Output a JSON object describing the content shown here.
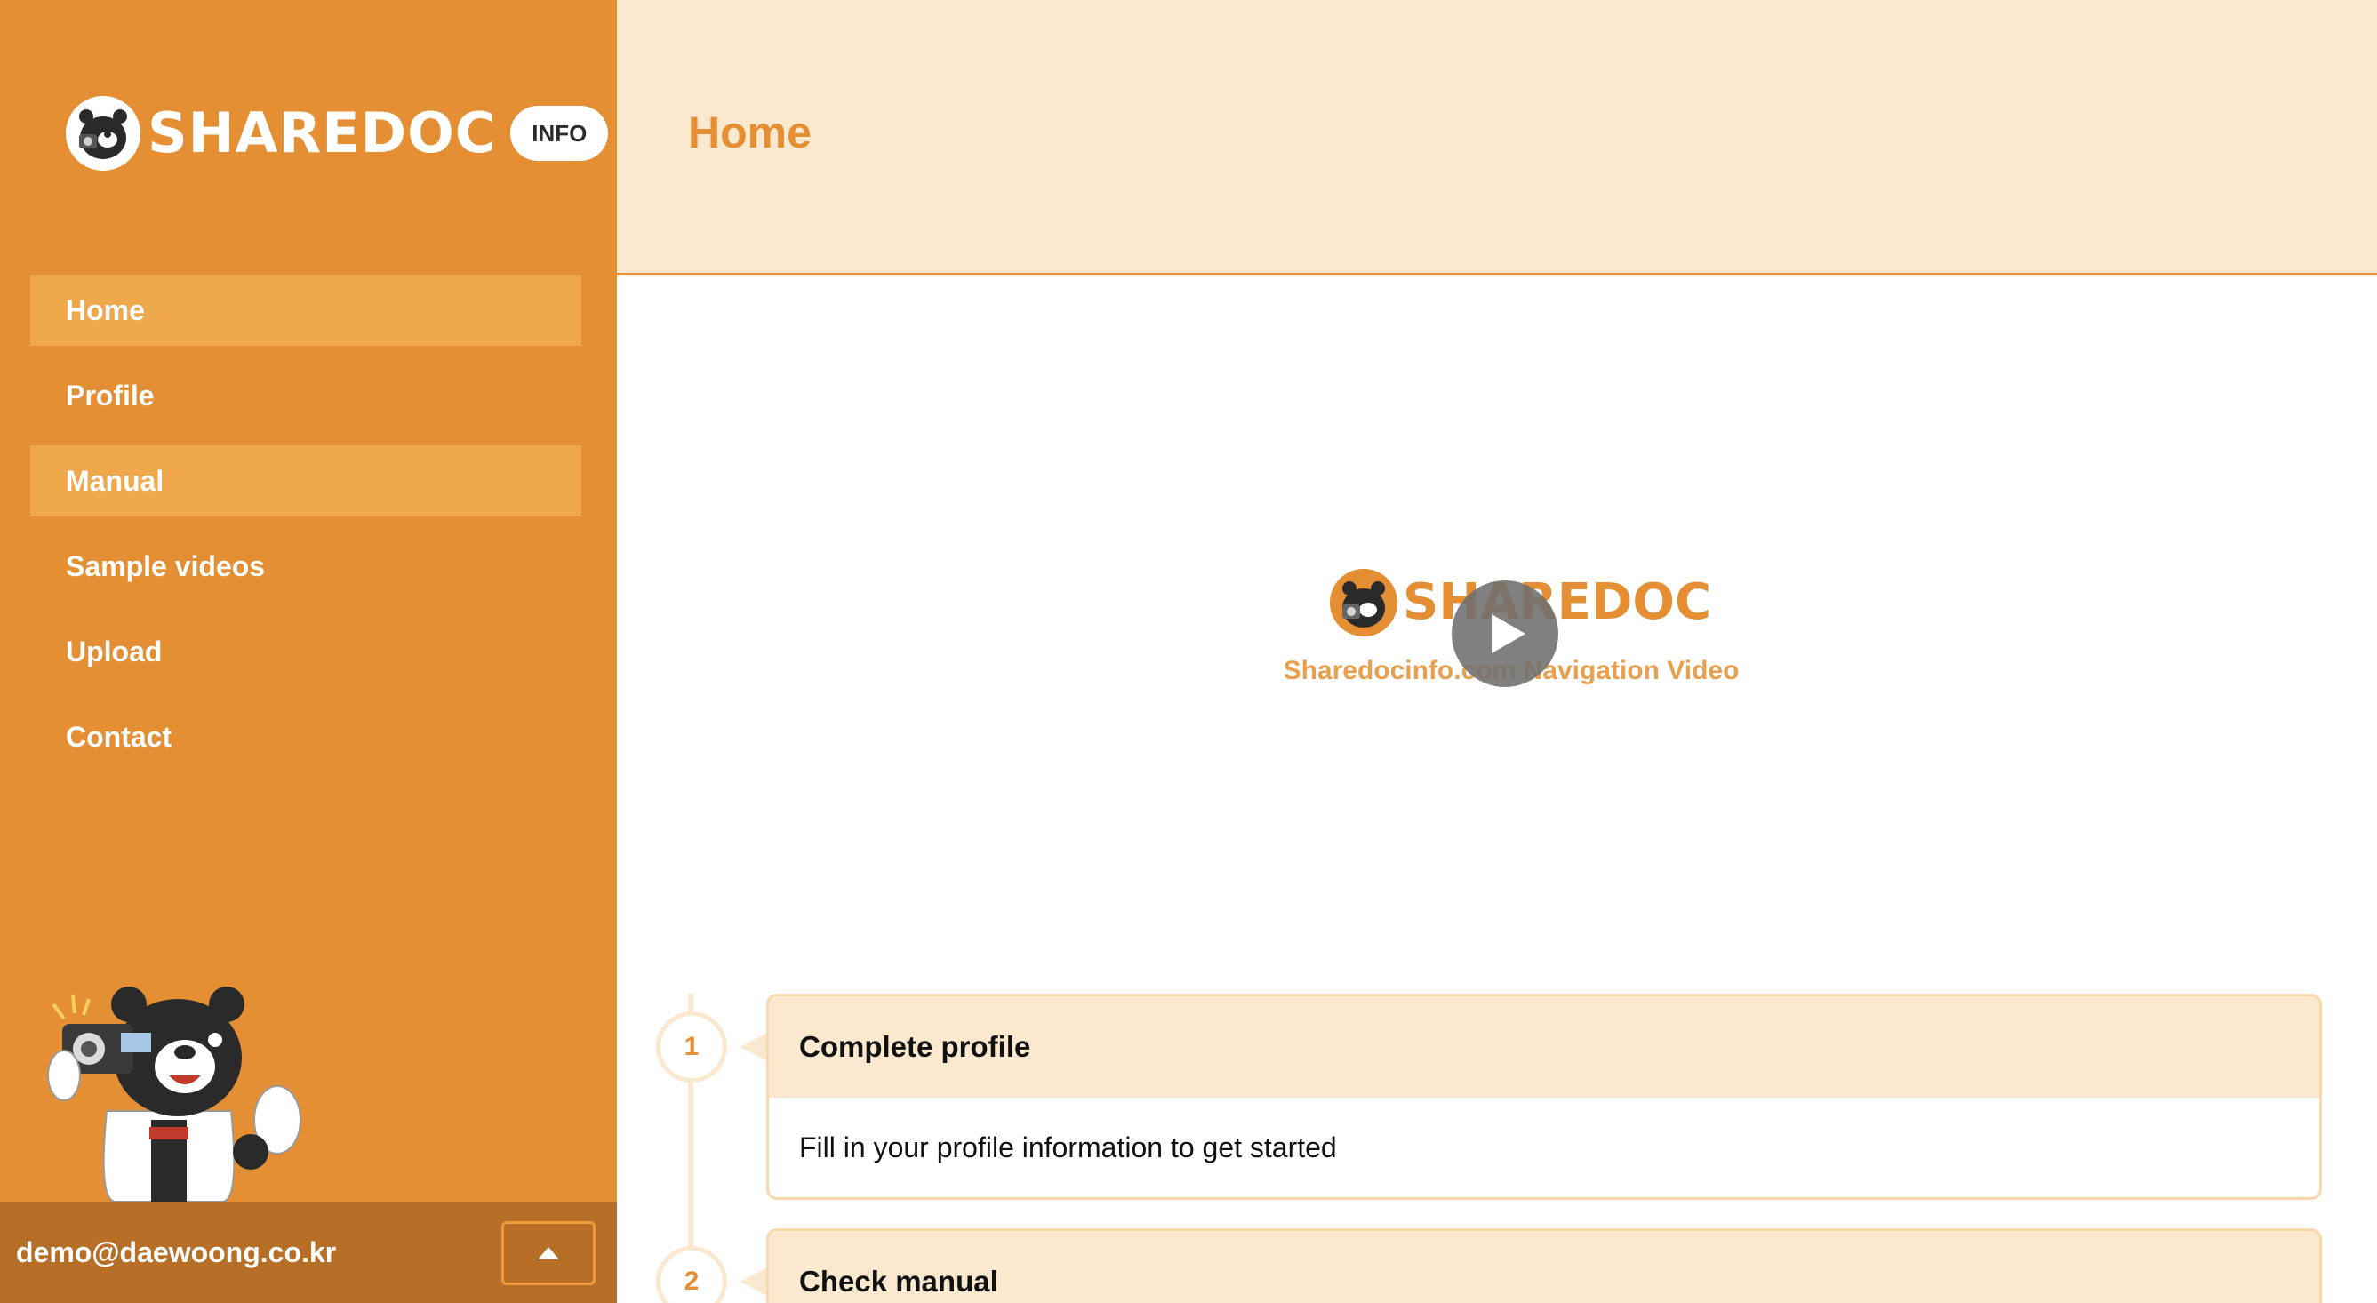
{
  "sidebar": {
    "logo_text": "SHAREDOC",
    "logo_badge": "INFO",
    "items": [
      {
        "label": "Home",
        "active": true
      },
      {
        "label": "Profile",
        "active": false
      },
      {
        "label": "Manual",
        "active": true
      },
      {
        "label": "Sample videos",
        "active": false
      },
      {
        "label": "Upload",
        "active": false
      },
      {
        "label": "Contact",
        "active": false
      }
    ],
    "user_email": "demo@daewoong.co.kr",
    "toggle_icon": "caret-up-icon"
  },
  "header": {
    "title": "Home"
  },
  "video": {
    "logo_text": "SHAREDOC",
    "subtitle": "Sharedocinfo.com Navigation Video",
    "play_icon": "play-icon"
  },
  "steps": [
    {
      "number": "1",
      "title": "Complete profile",
      "description": "Fill in your profile information to get started"
    },
    {
      "number": "2",
      "title": "Check manual",
      "description": ""
    }
  ],
  "colors": {
    "sidebar": "#E48F33",
    "sidebar_active": "#EFA84B",
    "user_bar": "#B76F27",
    "header_bg": "#FAE8CF",
    "accent": "#E48F33"
  }
}
